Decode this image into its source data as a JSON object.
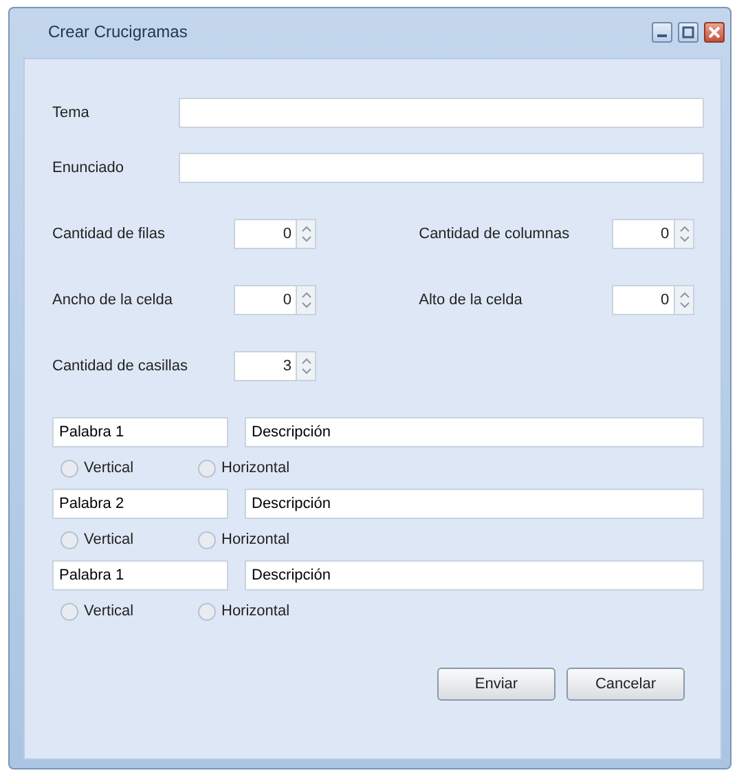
{
  "window": {
    "title": "Crear Crucigramas"
  },
  "fields": [
    {
      "label": "Tema"
    },
    {
      "label": "Enunciado"
    }
  ],
  "spinners": [
    [
      {
        "label": "Cantidad de filas",
        "value": "0"
      },
      {
        "label": "Cantidad de columnas",
        "value": "0"
      }
    ],
    [
      {
        "label": "Ancho de la celda",
        "value": "0"
      },
      {
        "label": "Alto de la celda",
        "value": "0"
      }
    ],
    [
      {
        "label": "Cantidad de casillas",
        "value": "3"
      }
    ]
  ],
  "words": [
    {
      "word": "Palabra 1",
      "description": "Descripción",
      "options": [
        {
          "label": "Vertical",
          "selected": false
        },
        {
          "label": "Horizontal",
          "selected": false
        }
      ]
    },
    {
      "word": "Palabra 2",
      "description": "Descripción",
      "options": [
        {
          "label": "Vertical",
          "selected": false
        },
        {
          "label": "Horizontal",
          "selected": false
        }
      ]
    },
    {
      "word": "Palabra 1",
      "description": "Descripción",
      "options": [
        {
          "label": "Vertical",
          "selected": false
        },
        {
          "label": "Horizontal",
          "selected": false
        }
      ]
    }
  ],
  "buttons": [
    "Enviar",
    "Cancelar"
  ]
}
